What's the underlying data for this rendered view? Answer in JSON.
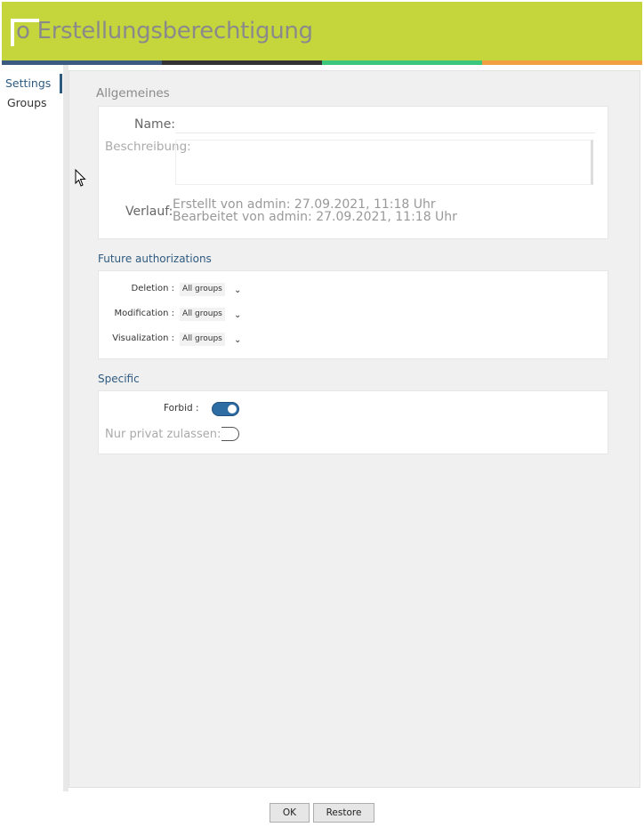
{
  "header": {
    "title": "o Erstellungsberechtigung",
    "stripe_colors": [
      "#3a5a80",
      "#333333",
      "#3cc87a",
      "#f0a040"
    ]
  },
  "sidebar": {
    "items": [
      {
        "label": "Settings",
        "active": true
      },
      {
        "label": "Groups",
        "active": false
      }
    ]
  },
  "general": {
    "heading": "Allgemeines",
    "name_label": "Name:",
    "name_value": "",
    "description_label": "Beschreibung:",
    "description_value": "",
    "history_label": "Verlauf:",
    "created": "Erstellt von admin: 27.09.2021, 11:18 Uhr",
    "edited": "Bearbeitet von admin: 27.09.2021, 11:18 Uhr"
  },
  "future_authorizations": {
    "heading": "Future authorizations",
    "rows": [
      {
        "label": "Deletion :",
        "value": "All groups"
      },
      {
        "label": "Modification :",
        "value": "All groups"
      },
      {
        "label": "Visualization :",
        "value": "All groups"
      }
    ]
  },
  "specific": {
    "heading": "Specific",
    "forbid_label": "Forbid :",
    "forbid_on": true,
    "private_label": "Nur privat zulassen:",
    "private_on": false
  },
  "footer": {
    "ok_label": "OK",
    "restore_label": "Restore"
  }
}
